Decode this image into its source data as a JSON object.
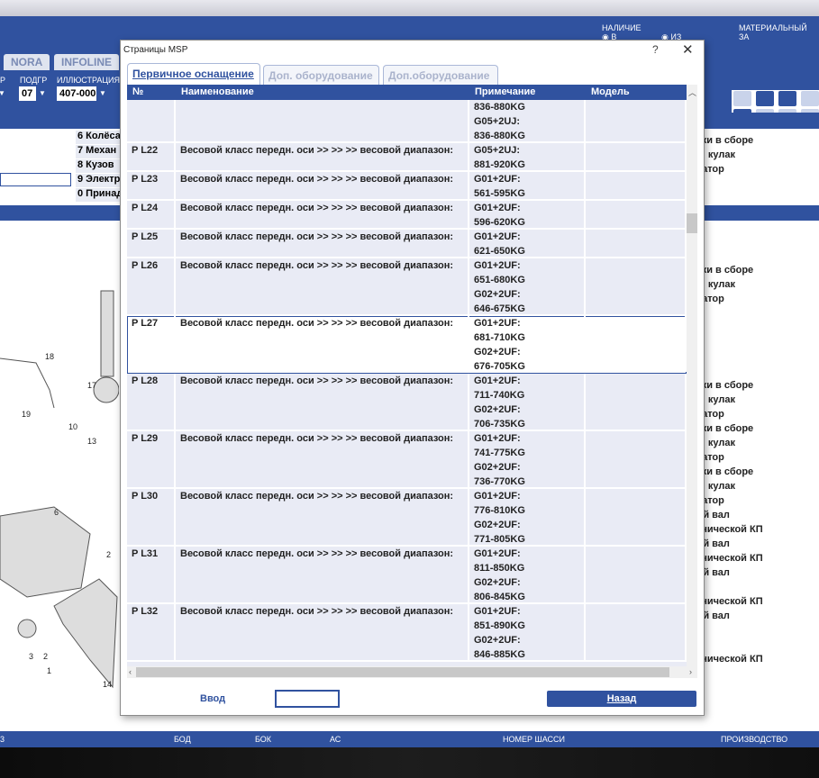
{
  "app": {
    "tabs": [
      "NORA",
      "INFOLINE"
    ],
    "selectors": {
      "podgr_label": "ПОДГР",
      "podgr_value": "07",
      "illustration_label": "ИЛЛЮСТРАЦИЯ",
      "illustration_value": "407-000",
      "left_label": "Р"
    },
    "availability": {
      "label": "НАЛИЧИЕ",
      "opt1": "В",
      "opt2": "ИЗ"
    },
    "material_label": "МАТЕРИАЛЬНЫЙ ЗА",
    "groups": [
      "6 Колёса",
      "7 Механ",
      "8 Кузов",
      "9 Электр",
      "0 Принад"
    ],
    "right_items": [
      "вески в сборе",
      "ный кулак",
      "лизатор",
      "вески в сборе",
      "ный кулак",
      "лизатор",
      "вески в сборе",
      "ный кулак",
      "лизатор",
      "вески в сборе",
      "ный кулак",
      "лизатор",
      "вески в сборе",
      "ный кулак",
      "лизатор",
      "дной вал",
      "еханической КП",
      "дной вал",
      "еханической КП",
      "дной вал",
      "еханической КП",
      "дной вал",
      "еханической КП"
    ],
    "diagram_labels": [
      "18",
      "17",
      "19",
      "10",
      "13",
      "6",
      "2",
      "3",
      "2",
      "1",
      "14"
    ],
    "bottom": [
      "3",
      "БОД",
      "БОК",
      "АС",
      "НОМЕР ШАССИ",
      "ПРОИЗВОДСТВО"
    ]
  },
  "dialog": {
    "title": "Страницы MSP",
    "help": "?",
    "close": "✕",
    "tabs": [
      "Первичное оснащение",
      "Доп. оборудование",
      "Доп.оборудование"
    ],
    "columns": [
      "№",
      "Наименование",
      "Примечание",
      "Модель"
    ],
    "rows": [
      {
        "no": "",
        "name": "",
        "note": [
          "836-880KG",
          "G05+2UJ:",
          "836-880KG"
        ],
        "model": ""
      },
      {
        "no": "P L22",
        "name": "Весовой класс передн. оси >> >> >> весовой диапазон:",
        "note": [
          "G05+2UJ:",
          "881-920KG"
        ],
        "model": ""
      },
      {
        "no": "P L23",
        "name": "Весовой класс передн. оси >> >> >> весовой диапазон:",
        "note": [
          "G01+2UF:",
          "561-595KG"
        ],
        "model": ""
      },
      {
        "no": "P L24",
        "name": "Весовой класс передн. оси >> >> >> весовой диапазон:",
        "note": [
          "G01+2UF:",
          "596-620KG"
        ],
        "model": ""
      },
      {
        "no": "P L25",
        "name": "Весовой класс передн. оси >> >> >> весовой диапазон:",
        "note": [
          "G01+2UF:",
          "621-650KG"
        ],
        "model": ""
      },
      {
        "no": "P L26",
        "name": "Весовой класс передн. оси >> >> >> весовой диапазон:",
        "note": [
          "G01+2UF:",
          "651-680KG",
          "G02+2UF:",
          "646-675KG"
        ],
        "model": ""
      },
      {
        "no": "P L27",
        "name": "Весовой класс передн. оси >> >> >> весовой диапазон:",
        "note": [
          "G01+2UF:",
          "681-710KG",
          "G02+2UF:",
          "676-705KG"
        ],
        "model": "",
        "selected": true
      },
      {
        "no": "P L28",
        "name": "Весовой класс передн. оси >> >> >> весовой диапазон:",
        "note": [
          "G01+2UF:",
          "711-740KG",
          "G02+2UF:",
          "706-735KG"
        ],
        "model": ""
      },
      {
        "no": "P L29",
        "name": "Весовой класс передн. оси >> >> >> весовой диапазон:",
        "note": [
          "G01+2UF:",
          "741-775KG",
          "G02+2UF:",
          "736-770KG"
        ],
        "model": ""
      },
      {
        "no": "P L30",
        "name": "Весовой класс передн. оси >> >> >> весовой диапазон:",
        "note": [
          "G01+2UF:",
          "776-810KG",
          "G02+2UF:",
          "771-805KG"
        ],
        "model": ""
      },
      {
        "no": "P L31",
        "name": "Весовой класс передн. оси >> >> >> весовой диапазон:",
        "note": [
          "G01+2UF:",
          "811-850KG",
          "G02+2UF:",
          "806-845KG"
        ],
        "model": ""
      },
      {
        "no": "P L32",
        "name": "Весовой класс передн. оси >> >> >> весовой диапазон:",
        "note": [
          "G01+2UF:",
          "851-890KG",
          "G02+2UF:",
          "846-885KG"
        ],
        "model": ""
      }
    ],
    "input_label": "Ввод",
    "input_value": "",
    "back_label": "Назад"
  }
}
